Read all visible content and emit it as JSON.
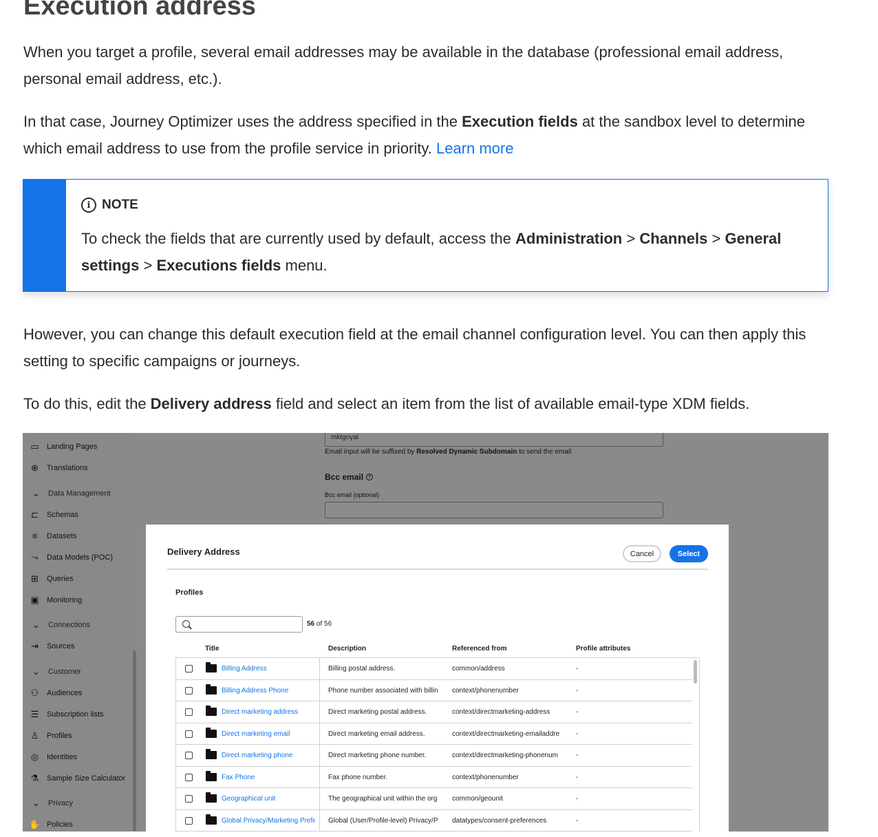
{
  "heading": "Execution address",
  "para1": "When you target a profile, several email addresses may be available in the database (professional email address, personal email address, etc.).",
  "para2": {
    "before": "In that case, Journey Optimizer uses the address specified in the ",
    "bold": "Execution fields",
    "after": " at the sandbox level to determine which email address to use from the profile service in priority. ",
    "link": "Learn more"
  },
  "note": {
    "label": "NOTE",
    "icon": "info-icon",
    "t1": "To check the fields that are currently used by default, access the ",
    "b1": "Administration",
    "t2": " > ",
    "b2": "Channels",
    "t3": " > ",
    "b3": "General settings",
    "t4": " > ",
    "b4": "Executions fields",
    "t5": " menu.",
    "accent_color": "#1473e6"
  },
  "para3": "However, you can change this default execution field at the email channel configuration level. You can then apply this setting to specific campaigns or journeys.",
  "para4": {
    "before": "To do this, edit the ",
    "bold": "Delivery address",
    "after": " field and select an item from the list of available email-type XDM fields."
  },
  "screenshot": {
    "sidebar": [
      {
        "label": "Landing Pages",
        "icon": "page-icon",
        "group": false
      },
      {
        "label": "Translations",
        "icon": "globe-icon",
        "group": false
      },
      {
        "label": "Data Management",
        "icon": "chevron-down-icon",
        "group": true
      },
      {
        "label": "Schemas",
        "icon": "schema-icon",
        "group": false
      },
      {
        "label": "Datasets",
        "icon": "database-icon",
        "group": false
      },
      {
        "label": "Data Models (POC)",
        "icon": "model-icon",
        "group": false
      },
      {
        "label": "Queries",
        "icon": "query-icon",
        "group": false
      },
      {
        "label": "Monitoring",
        "icon": "monitor-icon",
        "group": false
      },
      {
        "label": "Connections",
        "icon": "chevron-down-icon",
        "group": true
      },
      {
        "label": "Sources",
        "icon": "sources-icon",
        "group": false
      },
      {
        "label": "Customer",
        "icon": "chevron-down-icon",
        "group": true
      },
      {
        "label": "Audiences",
        "icon": "audiences-icon",
        "group": false
      },
      {
        "label": "Subscription lists",
        "icon": "list-icon",
        "group": false
      },
      {
        "label": "Profiles",
        "icon": "user-icon",
        "group": false
      },
      {
        "label": "Identities",
        "icon": "identity-icon",
        "group": false
      },
      {
        "label": "Sample Size Calculator",
        "icon": "flask-icon",
        "group": false
      },
      {
        "label": "Privacy",
        "icon": "chevron-down-icon",
        "group": true
      },
      {
        "label": "Policies",
        "icon": "hand-icon",
        "group": false
      }
    ],
    "top_input_value": "mktgoyal",
    "hint_before": "Email input will be suffixed by ",
    "hint_bold": "Resolved Dynamic Subdomain",
    "hint_after": " to send the email",
    "bcc_label": "Bcc email",
    "bcc_sub": "Bcc email (optional)",
    "dialog": {
      "title": "Delivery Address",
      "cancel": "Cancel",
      "select": "Select",
      "section": "Profiles",
      "count_bold": "56",
      "count_rest": " of 56",
      "columns": [
        "Title",
        "Description",
        "Referenced from",
        "Profile attributes"
      ],
      "rows": [
        {
          "title": "Billing Address",
          "desc": "Billing postal address.",
          "ref": "common/address",
          "attr": "-"
        },
        {
          "title": "Billing Address Phone",
          "desc": "Phone number associated with billin",
          "ref": "context/phonenumber",
          "attr": "-"
        },
        {
          "title": "Direct marketing address",
          "desc": "Direct marketing postal address.",
          "ref": "context/directmarketing-address",
          "attr": "-"
        },
        {
          "title": "Direct marketing email",
          "desc": "Direct marketing email address.",
          "ref": "context/directmarketing-emailaddre",
          "attr": "-"
        },
        {
          "title": "Direct marketing phone",
          "desc": "Direct marketing phone number.",
          "ref": "context/directmarketing-phonenum",
          "attr": "-"
        },
        {
          "title": "Fax Phone",
          "desc": "Fax phone number.",
          "ref": "context/phonenumber",
          "attr": "-"
        },
        {
          "title": "Geographical unit",
          "desc": "The geographical unit within the org",
          "ref": "common/geounit",
          "attr": "-"
        },
        {
          "title": "Global Privacy/Marketing Prefe",
          "desc": "Global (User/Profile-level) Privacy/P",
          "ref": "datatypes/consent-preferences",
          "attr": "-"
        }
      ]
    }
  }
}
